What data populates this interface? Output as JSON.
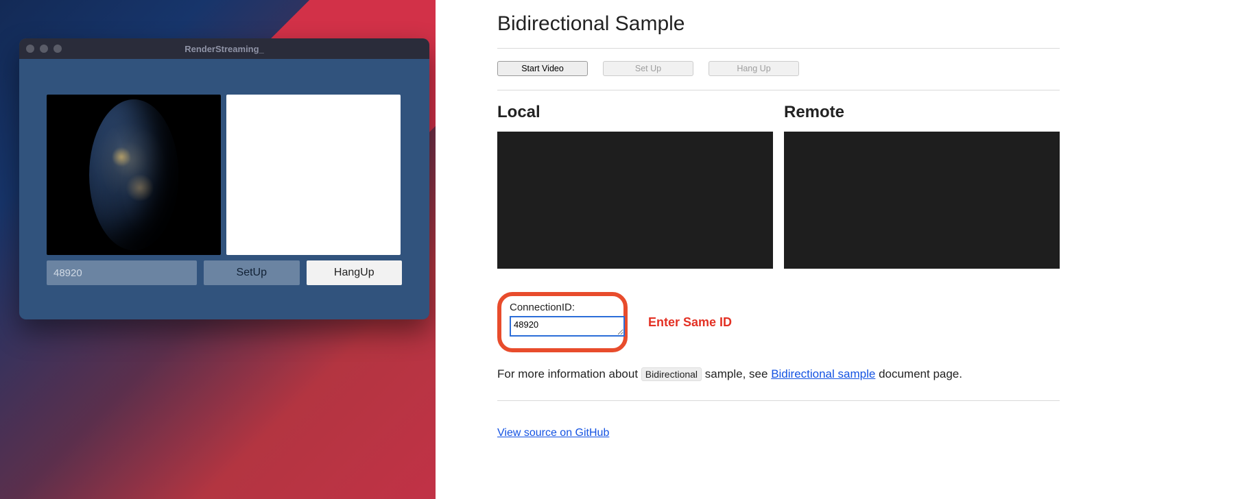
{
  "app": {
    "title": "RenderStreaming_",
    "connection_id_value": "48920",
    "setup_label": "SetUp",
    "hangup_label": "HangUp"
  },
  "web": {
    "title": "Bidirectional Sample",
    "buttons": {
      "start_video": "Start Video",
      "set_up": "Set Up",
      "hang_up": "Hang Up"
    },
    "local_label": "Local",
    "remote_label": "Remote",
    "connection_id_label": "ConnectionID:",
    "connection_id_value": "48920",
    "callout": "Enter Same ID",
    "info_prefix": "For more information about",
    "info_code": "Bidirectional",
    "info_mid": "sample, see",
    "info_link": "Bidirectional sample",
    "info_suffix": "document page.",
    "github_link": "View source on GitHub"
  }
}
